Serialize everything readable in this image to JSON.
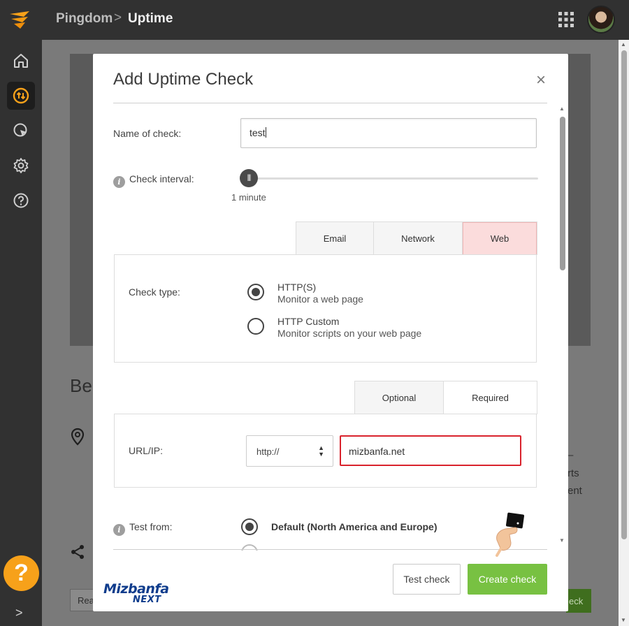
{
  "topbar": {
    "breadcrumb_parent": "Pingdom",
    "breadcrumb_separator": ">",
    "breadcrumb_current": "Uptime"
  },
  "sidenav": {
    "items": [
      {
        "icon": "home-icon"
      },
      {
        "icon": "uptime-icon",
        "active": true
      },
      {
        "icon": "cursor-icon"
      },
      {
        "icon": "gear-icon"
      },
      {
        "icon": "help-circle-icon"
      }
    ],
    "help_fab": "?",
    "expand": ">"
  },
  "background": {
    "heading_fragment": "Be",
    "dash": "–",
    "text_fragment_1": "rts",
    "text_fragment_2": "ent",
    "input_fragment": "Rea",
    "button_fragment": "eck"
  },
  "modal": {
    "title": "Add Uptime Check",
    "close": "×",
    "name_label": "Name of check:",
    "name_value": "test",
    "interval_label": "Check interval:",
    "interval_value": "1 minute",
    "interval_level": 0,
    "type_tabs": [
      {
        "label": "Email",
        "active": false
      },
      {
        "label": "Network",
        "active": false
      },
      {
        "label": "Web",
        "active": true
      }
    ],
    "check_type_label": "Check type:",
    "check_types": [
      {
        "title": "HTTP(S)",
        "subtitle": "Monitor a web page",
        "checked": true
      },
      {
        "title": "HTTP Custom",
        "subtitle": "Monitor scripts on your web page",
        "checked": false
      }
    ],
    "field_tabs": [
      {
        "label": "Optional",
        "active": false
      },
      {
        "label": "Required",
        "active": true
      }
    ],
    "url_label": "URL/IP:",
    "protocol": "http://",
    "url_value": "mizbanfa.net",
    "test_from_label": "Test from:",
    "test_from_option": "Default (North America and Europe)",
    "buttons": {
      "test": "Test check",
      "create": "Create check"
    }
  },
  "watermark": {
    "line1": "Mizbanfa",
    "line2": "NEXT"
  },
  "colors": {
    "accent_orange": "#f7a11a",
    "create_green": "#78c142",
    "url_border_red": "#d9232d",
    "web_tab_pink": "#fbdcdc"
  }
}
